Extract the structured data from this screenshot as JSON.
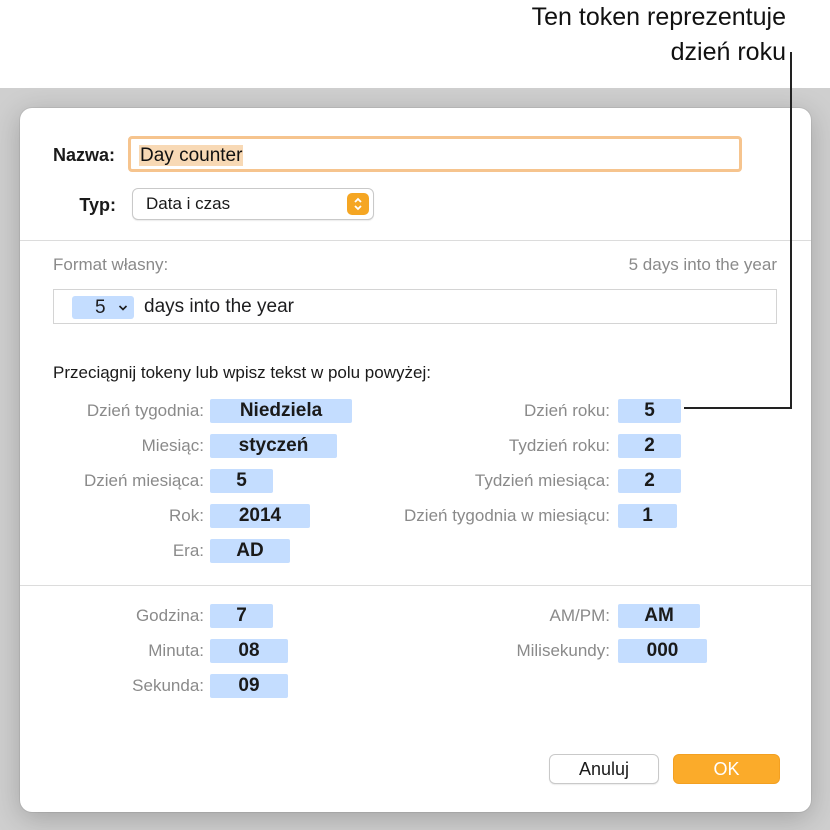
{
  "callout": {
    "line1": "Ten token reprezentuje",
    "line2": "dzień roku"
  },
  "dialog": {
    "name_label": "Nazwa:",
    "name_value": "Day counter",
    "type_label": "Typ:",
    "type_value": "Data i czas",
    "format_label": "Format własny:",
    "format_preview": "5 days into the year",
    "format_token": "5",
    "format_text": "days into the year",
    "instructions": "Przeciągnij tokeny lub wpisz tekst w polu powyżej:",
    "date_tokens_left": [
      {
        "label": "Dzień tygodnia:",
        "value": "Niedziela"
      },
      {
        "label": "Miesiąc:",
        "value": "styczeń"
      },
      {
        "label": "Dzień miesiąca:",
        "value": "5"
      },
      {
        "label": "Rok:",
        "value": "2014"
      },
      {
        "label": "Era:",
        "value": "AD"
      }
    ],
    "date_tokens_right": [
      {
        "label": "Dzień roku:",
        "value": "5"
      },
      {
        "label": "Tydzień roku:",
        "value": "2"
      },
      {
        "label": "Tydzień miesiąca:",
        "value": "2"
      },
      {
        "label": "Dzień tygodnia w miesiącu:",
        "value": "1"
      }
    ],
    "time_tokens_left": [
      {
        "label": "Godzina:",
        "value": "7"
      },
      {
        "label": "Minuta:",
        "value": "08"
      },
      {
        "label": "Sekunda:",
        "value": "09"
      }
    ],
    "time_tokens_right": [
      {
        "label": "AM/PM:",
        "value": "AM"
      },
      {
        "label": "Milisekundy:",
        "value": "000"
      }
    ],
    "cancel_label": "Anuluj",
    "ok_label": "OK"
  },
  "colors": {
    "accent": "#fbab2a",
    "token": "#c4ddff",
    "focus_ring": "#f6c48e"
  },
  "icons": {
    "stepper": "up-down-stepper-icon",
    "dropdown": "chevron-down-icon"
  }
}
